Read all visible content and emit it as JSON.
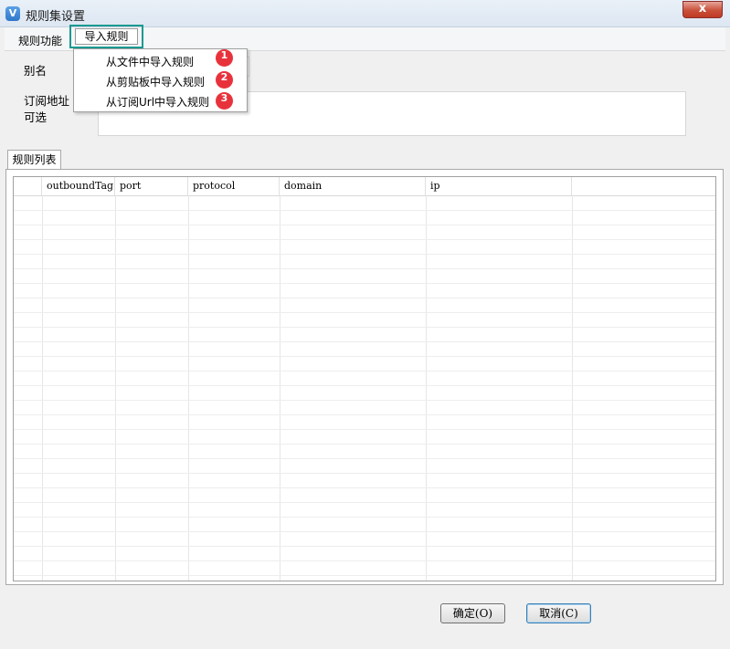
{
  "window": {
    "title": "规则集设置",
    "close_label": "x",
    "icon_glyph": "V"
  },
  "menu": {
    "items": [
      {
        "label": "规则功能"
      },
      {
        "label": "导入规则"
      }
    ],
    "highlight_color": "#1a9a91"
  },
  "form": {
    "alias_label": "别名",
    "alias_value": "",
    "subscription_label_line1": "订阅地址（",
    "subscription_label_line2": "可选",
    "subscription_value": ""
  },
  "dropdown": {
    "items": [
      {
        "label": "从文件中导入规则",
        "badge": "1"
      },
      {
        "label": "从剪贴板中导入规则",
        "badge": "2"
      },
      {
        "label": "从订阅Url中导入规则",
        "badge": "3"
      }
    ],
    "badge_color": "#e8323b"
  },
  "tab": {
    "label": "规则列表"
  },
  "table": {
    "columns": [
      "",
      "outboundTag",
      "port",
      "protocol",
      "domain",
      "ip",
      ""
    ],
    "rows": []
  },
  "buttons": {
    "ok": "确定(O)",
    "cancel": "取消(C)"
  }
}
